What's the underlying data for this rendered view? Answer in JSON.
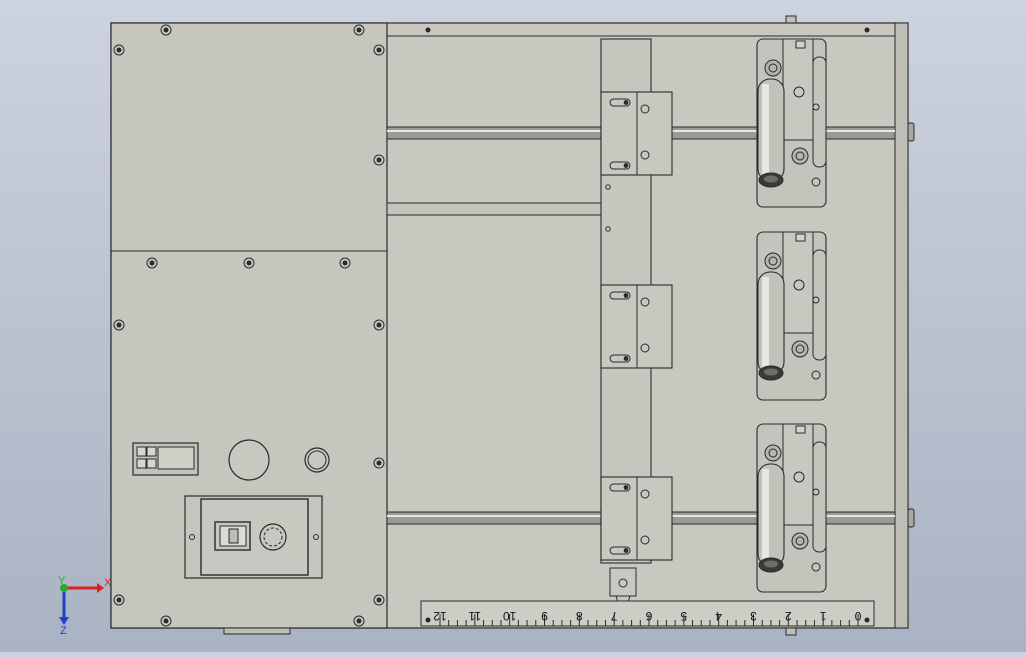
{
  "colors": {
    "background_top": "#cdd3de",
    "background_bottom": "#aab3c3",
    "plate": "#c8c8c1",
    "stroke": "#2a2a2a",
    "axis_x": "#e02020",
    "axis_y": "#20b020",
    "axis_z": "#2040d0"
  },
  "view_triad": {
    "x_label": "X",
    "y_label": "Y",
    "z_label": "Z"
  },
  "ruler": {
    "labels": [
      "12",
      "11",
      "10",
      "9",
      "8",
      "7",
      "6",
      "5",
      "4",
      "3",
      "2",
      "1",
      "0"
    ]
  },
  "components": {
    "display_icon": "digital-display-icon",
    "power_switch_icon": "rocker-switch-icon",
    "knob_icon": "rotary-knob-icon"
  }
}
